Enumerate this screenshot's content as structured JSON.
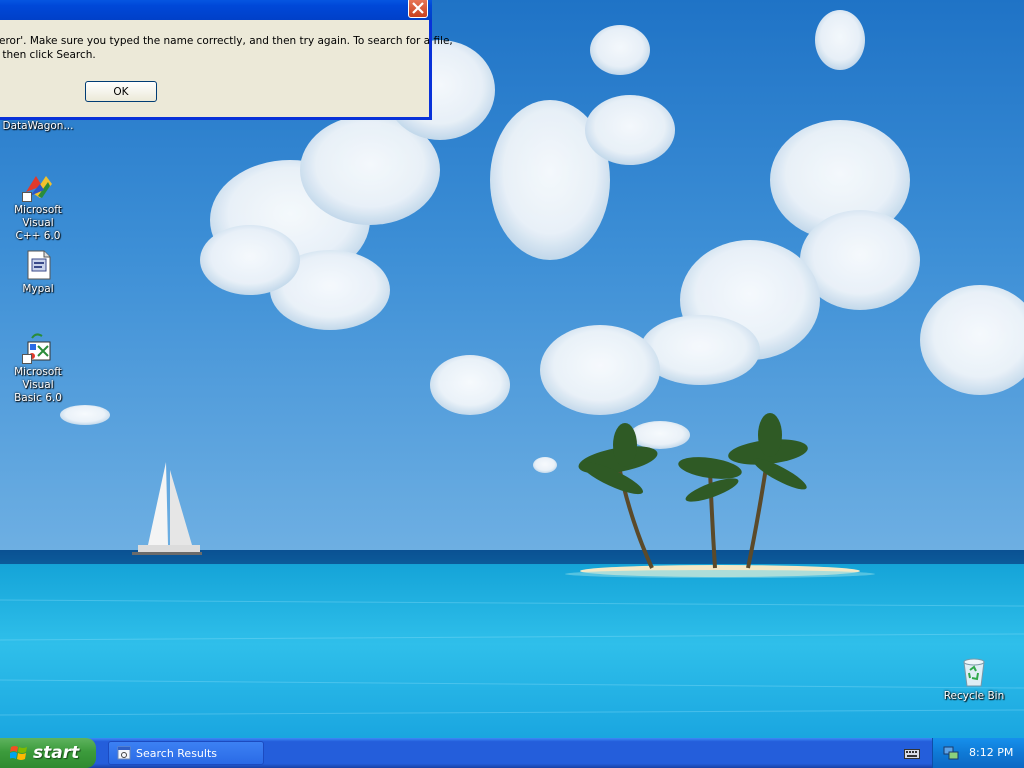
{
  "dialog": {
    "message_line1": "eror'. Make sure you typed the name correctly, and then try again. To search for a file,",
    "message_line2": " then click Search.",
    "ok_label": "OK"
  },
  "desktop_icons": {
    "datawagon": "DataWagon...",
    "vcpp_line1": "Microsoft Visual",
    "vcpp_line2": "C++ 6.0",
    "mypal": "Mypal",
    "vb_line1": "Microsoft Visual",
    "vb_line2": "Basic 6.0",
    "recycle_bin": "Recycle Bin"
  },
  "taskbar": {
    "start_label": "start",
    "task_search_results": "Search Results",
    "clock": "8:12 PM"
  },
  "icons": {
    "start": "windows-flag-icon",
    "task": "search-window-icon",
    "keyboard": "keyboard-icon",
    "network": "network-icon",
    "recycle": "recycle-bin-icon"
  },
  "colors": {
    "taskbar": "#245edb",
    "start_button": "#3c9b3c",
    "tray": "#0f7ad6",
    "dialog_face": "#ece9d8",
    "dialog_border": "#0831d9",
    "close_button": "#d35a36"
  }
}
